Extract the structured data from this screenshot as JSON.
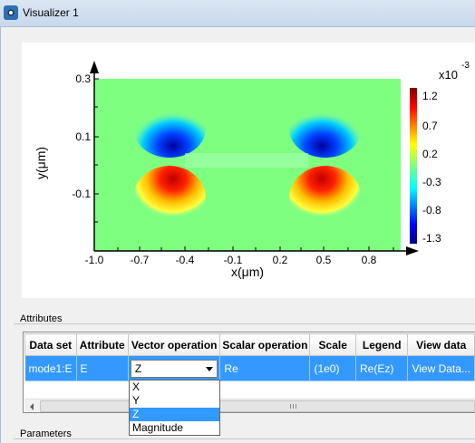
{
  "window": {
    "title": "Visualizer 1",
    "icon": "visualizer-app-icon"
  },
  "plot": {
    "xlabel": "x(μm)",
    "ylabel": "y(μm)",
    "x_ticks": [
      "-1.0",
      "-0.7",
      "-0.4",
      "-0.1",
      "0.2",
      "0.5",
      "0.8"
    ],
    "y_ticks": [
      "0.3",
      "0.1",
      "-0.1"
    ],
    "colorbar": {
      "exponent_base": "x10",
      "exponent": "-3",
      "ticks": [
        "1.2",
        "0.7",
        "0.2",
        "-0.3",
        "-0.8",
        "-1.3"
      ]
    },
    "colormap": "jet"
  },
  "chart_data": {
    "type": "heatmap",
    "xlabel": "x(μm)",
    "ylabel": "y(μm)",
    "xlim": [
      -1.2,
      1.1
    ],
    "ylim": [
      -0.45,
      0.3
    ],
    "colorbar_range": [
      -1.3,
      1.3
    ],
    "colorbar_multiplier": "x10^-3",
    "features": [
      {
        "x": -0.47,
        "y": 0.07,
        "sign": "negative",
        "peak": -1.3
      },
      {
        "x": 0.47,
        "y": 0.07,
        "sign": "negative",
        "peak": -1.3
      },
      {
        "x": -0.47,
        "y": -0.07,
        "sign": "positive",
        "peak": 1.2
      },
      {
        "x": 0.47,
        "y": -0.07,
        "sign": "positive",
        "peak": 1.2
      }
    ]
  },
  "attributes": {
    "group_label": "Attributes",
    "columns": [
      "Data set",
      "Attribute",
      "Vector operation",
      "Scalar operation",
      "Scale",
      "Legend",
      "View data"
    ],
    "row": {
      "data_set": "mode1:E",
      "attribute": "E",
      "vector_operation": "Z",
      "scalar_operation": "Re",
      "scale": "(1e0)",
      "legend": "Re(Ez)",
      "view_data": "View Data..."
    },
    "vector_options": [
      "X",
      "Y",
      "Z",
      "Magnitude"
    ],
    "selected_option": "Z"
  },
  "parameters": {
    "group_label": "Parameters"
  }
}
